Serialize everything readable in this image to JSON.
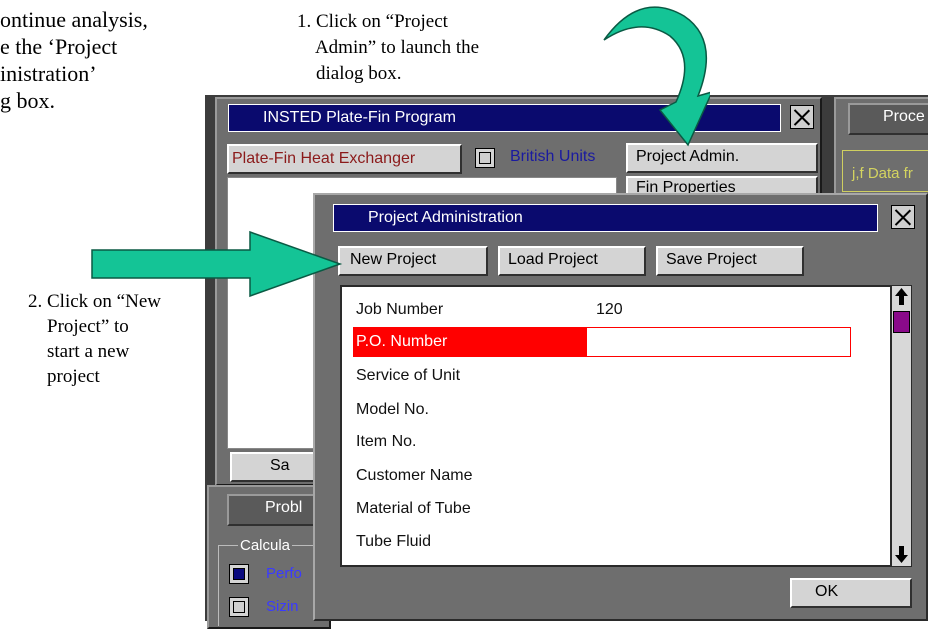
{
  "annotations": {
    "intro": "ontinue analysis,\ne the ‘Project\ninistration’\ng box.",
    "step1": "1. Click on “Project\n    Admin” to launch the\n    dialog box.",
    "step2": "2. Click on “New\n    Project” to\n    start a new\n    project"
  },
  "colors": {
    "arrow": "#14c496",
    "arrow_outline": "#0a5a44",
    "title_bar": "#0a0a6e",
    "highlight_row": "#ff0000",
    "scroll_thumb": "#8a0a8a"
  },
  "back_window": {
    "title": "INSTED Plate-Fin Program",
    "program_label": "Plate-Fin Heat Exchanger",
    "units_label": "British Units",
    "buttons": {
      "project_admin": "Project Admin.",
      "fin_properties": "Fin Properties",
      "save_partial": "Sa"
    },
    "right_panel": {
      "button_partial": "Proce",
      "data_label": "j,f Data fr"
    },
    "problem_panel": {
      "button_partial": "Probl",
      "group_label": "Calcula",
      "options": [
        {
          "label": "Perfo",
          "checked": true
        },
        {
          "label": "Sizin",
          "checked": false
        }
      ]
    }
  },
  "dialog": {
    "title": "Project Administration",
    "buttons": {
      "new_project": "New Project",
      "load_project": "Load Project",
      "save_project": "Save Project",
      "ok": "OK"
    },
    "fields": [
      {
        "label": "Job Number",
        "value": "120"
      },
      {
        "label": "P.O. Number",
        "value": "",
        "selected": true
      },
      {
        "label": "Service of Unit",
        "value": ""
      },
      {
        "label": "Model No.",
        "value": ""
      },
      {
        "label": "Item No.",
        "value": ""
      },
      {
        "label": "Customer Name",
        "value": ""
      },
      {
        "label": "Material of Tube",
        "value": ""
      },
      {
        "label": "Tube Fluid",
        "value": ""
      }
    ],
    "scroll_up_icon": "arrow-up-icon",
    "scroll_down_icon": "arrow-down-icon"
  }
}
